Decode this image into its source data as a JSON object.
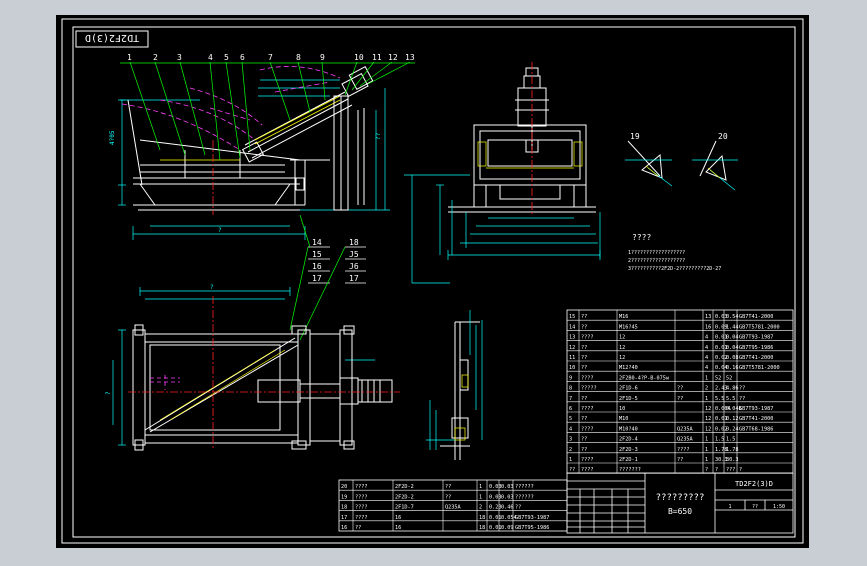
{
  "colors": {
    "background": "#c9ced4",
    "sheet": "#000000",
    "frame": "#ffffff",
    "geometry": "#ffffff",
    "dimension": "#00ffff",
    "hidden": "#ff3fff",
    "section": "#ffff00",
    "center": "#ff2020",
    "leader": "#00ff00"
  },
  "title_tag": "TD2F2(3)D",
  "view_labels": [
    "19",
    "20"
  ],
  "notes": {
    "title": "????",
    "lines": [
      "1??????????????????",
      "2??????????????????",
      "3??????????2F2D-2?????????2D-27"
    ]
  },
  "balloons_side": [
    "1",
    "2",
    "3",
    "4",
    "5",
    "6",
    "7",
    "8",
    "9",
    "10",
    "11",
    "12",
    "13"
  ],
  "balloons_mid": [
    "14",
    "15",
    "16",
    "17"
  ],
  "balloons_right": [
    "18",
    "J5",
    "J6",
    "17"
  ],
  "dims_side": [
    "4?05",
    "?",
    "??"
  ],
  "bom_upper": {
    "rows": [
      [
        "15",
        "??",
        "M16",
        "",
        "13",
        "0.03",
        "0.54",
        "GB7T41-2000"
      ],
      [
        "14",
        "??",
        "M16?45",
        "",
        "16",
        "0.09",
        "1.44",
        "GB7T5781-2000"
      ],
      [
        "13",
        "????",
        "12",
        "",
        "4",
        "0.01",
        "0.04",
        "GB7T93-1987"
      ],
      [
        "12",
        "??",
        "12",
        "",
        "4",
        "0.01",
        "0.04",
        "GB7T95-1986"
      ],
      [
        "11",
        "??",
        "12",
        "",
        "4",
        "0.02",
        "0.08",
        "GB7T41-2000"
      ],
      [
        "10",
        "??",
        "M12?40",
        "",
        "4",
        "0.04",
        "0.16",
        "GB7T5781-2000"
      ],
      [
        "9",
        "????",
        "2F2B0-4?P-B-075w",
        "",
        "1",
        "52",
        "52",
        ""
      ],
      [
        "8",
        "?????",
        "2F1D-6",
        "??",
        "2",
        "2.43",
        "4.86",
        "??"
      ],
      [
        "7",
        "??",
        "2F1D-5",
        "??",
        "1",
        "5.5",
        "5.5",
        "??"
      ],
      [
        "6",
        "????",
        "10",
        "",
        "12",
        "0.004",
        "0.048",
        "GB7T93-1987"
      ],
      [
        "5",
        "??",
        "M10",
        "",
        "12",
        "0.01",
        "0.12",
        "GB7T41-2000"
      ],
      [
        "4",
        "????",
        "M10?40",
        "Q235A",
        "12",
        "0.02",
        "0.24",
        "GB7T68-1986"
      ],
      [
        "3",
        "??",
        "2F2D-4",
        "Q235A",
        "1",
        "1.5",
        "1.5",
        ""
      ],
      [
        "2",
        "??",
        "2F2D-3",
        "????",
        "1",
        "1.78",
        "1.78",
        ""
      ],
      [
        "1",
        "????",
        "2F2D-1",
        "??",
        "1",
        "30.3",
        "30.3",
        ""
      ]
    ],
    "header": [
      "??",
      "????",
      "???????",
      "?",
      "?",
      "???",
      "?"
    ]
  },
  "bom_lower": {
    "rows": [
      [
        "20",
        "????",
        "2F2D-2",
        "??",
        "1",
        "0.03",
        "0.03",
        "??????"
      ],
      [
        "19",
        "????",
        "2F2D-2",
        "??",
        "1",
        "0.03",
        "0.03",
        "??????"
      ],
      [
        "18",
        "????",
        "2F1D-7",
        "Q235A",
        "2",
        "0.23",
        "0.46",
        "??"
      ],
      [
        "17",
        "????",
        "16",
        "",
        "18",
        "0.01",
        "0.054",
        "GB7T93-1987"
      ],
      [
        "16",
        "??",
        "16",
        "",
        "18",
        "0.01",
        "0.09",
        "GB7T95-1986"
      ]
    ]
  },
  "title_block": {
    "name": "?????????",
    "spec": "B=650",
    "drawing_no": "TD2F2(3)D",
    "small": [
      "1",
      "??",
      "1:50"
    ]
  }
}
